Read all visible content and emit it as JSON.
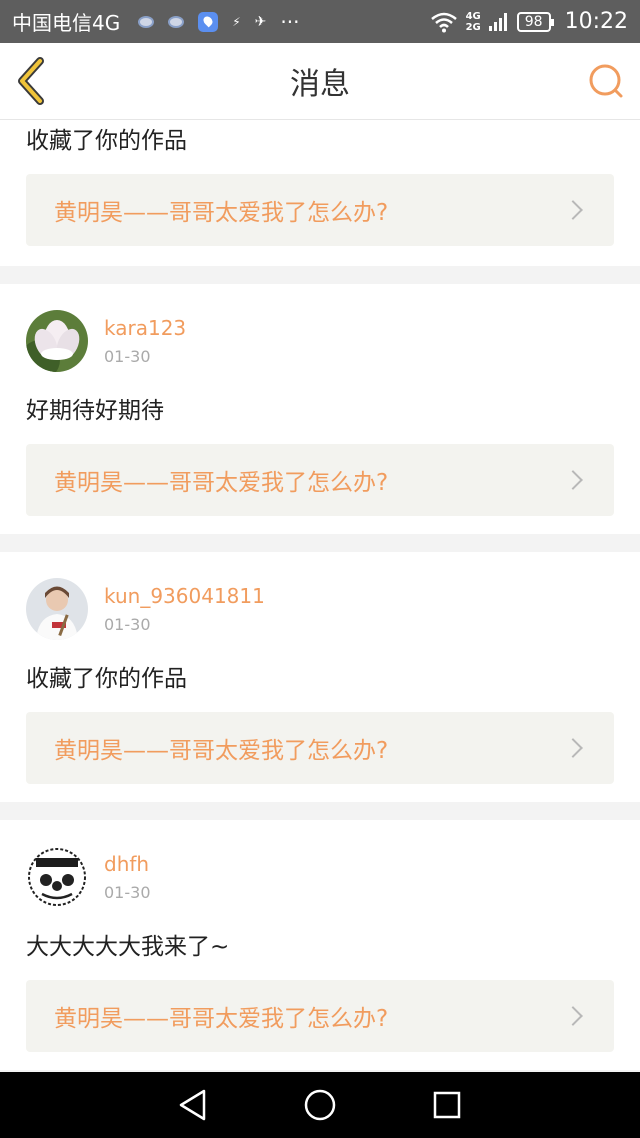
{
  "status_bar": {
    "carrier": "中国电信4G",
    "more": "···",
    "net_top": "4G",
    "net_bottom": "2G",
    "battery": "98",
    "time": "10:22"
  },
  "header": {
    "title": "消息"
  },
  "colors": {
    "accent": "#f19c5e",
    "back_icon": "#f0c43a",
    "card_work_bg": "#f3f3ef"
  },
  "feed": {
    "items": [
      {
        "message": "收藏了你的作品",
        "work_title": "黄明昊——哥哥太爱我了怎么办?"
      },
      {
        "username": "kara123",
        "date": "01-30",
        "message": "好期待好期待",
        "work_title": "黄明昊——哥哥太爱我了怎么办?"
      },
      {
        "username": "kun_936041811",
        "date": "01-30",
        "message": "收藏了你的作品",
        "work_title": "黄明昊——哥哥太爱我了怎么办?"
      },
      {
        "username": "dhfh",
        "date": "01-30",
        "message": "大大大大大我来了~",
        "work_title": "黄明昊——哥哥太爱我了怎么办?"
      }
    ]
  }
}
